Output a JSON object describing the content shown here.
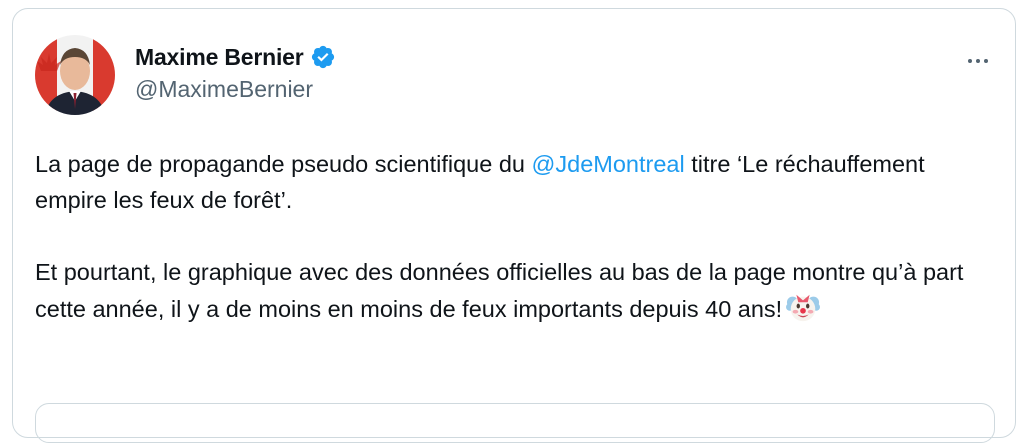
{
  "author": {
    "display_name": "Maxime Bernier",
    "handle": "@MaximeBernier",
    "verified": true,
    "verified_color": "#1d9bf0"
  },
  "tweet": {
    "paragraph1": {
      "before_mention": "La page de propagande pseudo scientifique du ",
      "mention": "@JdeMontreal",
      "after_mention": " titre ‘Le réchauffement empire les feux de forêt’."
    },
    "paragraph2": {
      "text": "Et pourtant, le graphique avec des données officielles au bas de la page montre qu’à part cette année, il y a de moins en moins de feux importants depuis 40 ans!",
      "emoji": "clown-face-icon"
    }
  },
  "colors": {
    "text": "#0f1419",
    "secondary": "#536471",
    "link": "#1d9bf0",
    "border": "#cfd9de"
  },
  "icons": {
    "more": "more-horizontal-icon",
    "verified": "verified-badge-icon"
  }
}
